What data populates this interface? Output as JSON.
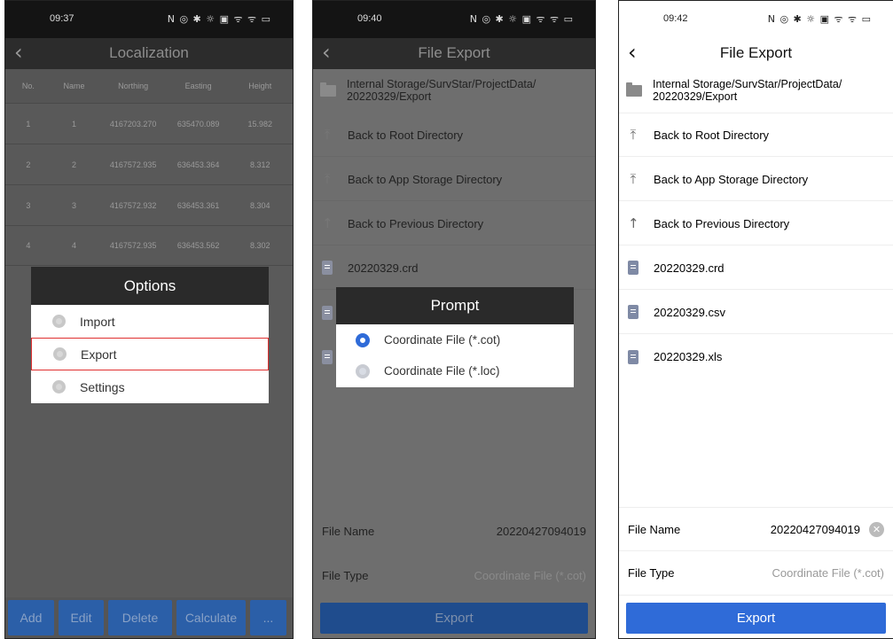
{
  "screen1": {
    "time": "09:37",
    "status_icons": "N ◎ ✱ ☼ ▣ ᯤ ᯤ ▭",
    "title": "Localization",
    "columns": [
      "No.",
      "Name",
      "Northing",
      "Easting",
      "Height"
    ],
    "rows": [
      [
        "1",
        "1",
        "4167203.270",
        "635470.089",
        "15.982"
      ],
      [
        "2",
        "2",
        "4167572.935",
        "636453.364",
        "8.312"
      ],
      [
        "3",
        "3",
        "4167572.932",
        "636453.361",
        "8.304"
      ],
      [
        "4",
        "4",
        "4167572.935",
        "636453.562",
        "8.302"
      ]
    ],
    "options_dialog": {
      "title": "Options",
      "items": [
        "Import",
        "Export",
        "Settings"
      ],
      "highlighted": "Export"
    },
    "bottom_buttons": [
      "Add",
      "Edit",
      "Delete",
      "Calculate",
      "..."
    ]
  },
  "screen2": {
    "time": "09:40",
    "status_icons": "N ◎ ✱ ☼ ▣ ᯤ ᯤ ▭",
    "title": "File Export",
    "path": "Internal Storage/SurvStar/ProjectData/ 20220329/Export",
    "nav": [
      "Back to Root Directory",
      "Back to App Storage Directory",
      "Back to Previous Directory"
    ],
    "files": [
      "20220329.crd"
    ],
    "prompt": {
      "title": "Prompt",
      "options": [
        "Coordinate File (*.cot)",
        "Coordinate File (*.loc)"
      ],
      "selected": "Coordinate File (*.cot)"
    },
    "file_name_label": "File Name",
    "file_name_value": "20220427094019",
    "file_type_label": "File Type",
    "file_type_value": "Coordinate File (*.cot)",
    "export_label": "Export"
  },
  "screen3": {
    "time": "09:42",
    "status_icons": "N ◎ ✱ ☼ ▣ ᯤ ᯤ ▭",
    "title": "File Export",
    "path": "Internal Storage/SurvStar/ProjectData/ 20220329/Export",
    "nav": [
      "Back to Root Directory",
      "Back to App Storage Directory",
      "Back to Previous Directory"
    ],
    "files": [
      "20220329.crd",
      "20220329.csv",
      "20220329.xls"
    ],
    "file_name_label": "File Name",
    "file_name_value": "20220427094019",
    "file_type_label": "File Type",
    "file_type_value": "Coordinate File (*.cot)",
    "export_label": "Export"
  }
}
